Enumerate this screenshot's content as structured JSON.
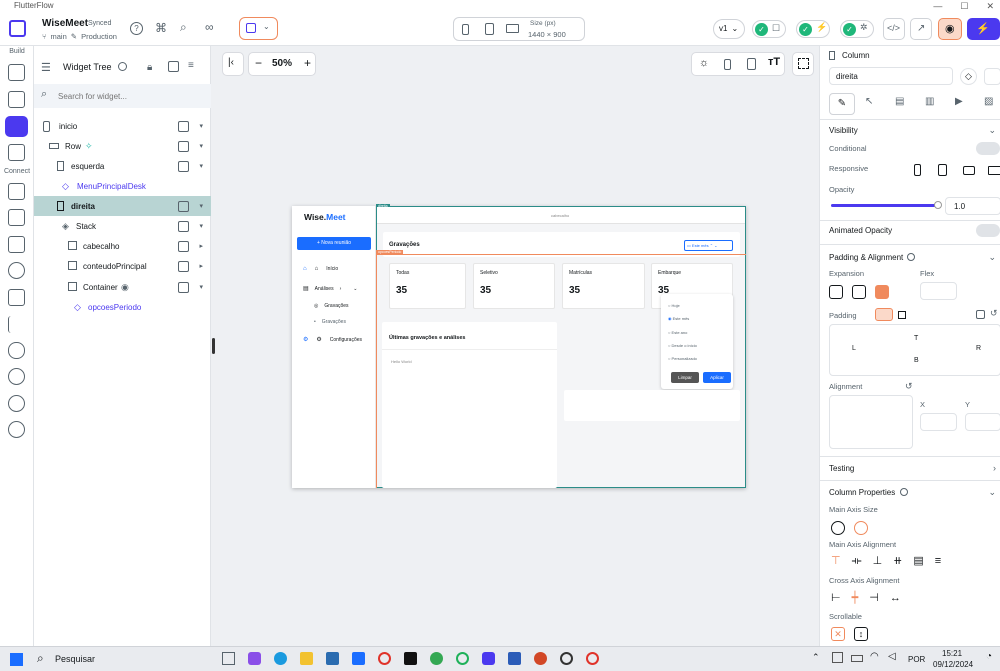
{
  "window": {
    "title": "FlutterFlow"
  },
  "topbar": {
    "project_name": "WiseMeet",
    "sync_status": "Synced",
    "branch": "main",
    "environment": "Production",
    "size_label": "Size (px)",
    "size_value": "1440 × 900",
    "version": "v1"
  },
  "rail": {
    "build_label": "Build",
    "connect_label": "Connect"
  },
  "tree": {
    "title": "Widget Tree",
    "search_placeholder": "Search for widget...",
    "items": [
      {
        "label": "inicio"
      },
      {
        "label": "Row"
      },
      {
        "label": "esquerda"
      },
      {
        "label": "MenuPrincipalDesk"
      },
      {
        "label": "direita"
      },
      {
        "label": "Stack"
      },
      {
        "label": "cabecalho"
      },
      {
        "label": "conteudoPrincipal"
      },
      {
        "label": "Container"
      },
      {
        "label": "opcoesPeriodo"
      }
    ]
  },
  "canvas": {
    "zoom": "50%"
  },
  "preview": {
    "logo_a": "Wise.",
    "logo_b": "Meet",
    "new_meeting_button": "+ Nova reunião",
    "nav": [
      {
        "label": "Início"
      },
      {
        "label": "Análises"
      },
      {
        "label": "Gravações"
      },
      {
        "label": "Gravações"
      },
      {
        "label": "Configurações"
      }
    ],
    "direita_tag": "direita",
    "header_label": "cabecalho",
    "section_title": "Gravações",
    "opcoes_tag": "opcoesPeriodo",
    "period_button": "Este mês",
    "stats": [
      {
        "label": "Todas",
        "value": "35"
      },
      {
        "label": "Seletivo",
        "value": "35"
      },
      {
        "label": "Matrículas",
        "value": "35"
      },
      {
        "label": "Embarque",
        "value": "35"
      }
    ],
    "period_options": [
      "Hoje",
      "Este mês",
      "Este ano",
      "Desde o início",
      "Personalizado"
    ],
    "clear_button": "Limpar",
    "apply_button": "Aplicar",
    "recent_title": "Últimas gravações e análises",
    "recent_body": "Hello World"
  },
  "props": {
    "widget_type": "Column",
    "widget_name": "direita",
    "visibility": "Visibility",
    "conditional": "Conditional",
    "responsive": "Responsive",
    "opacity": "Opacity",
    "opacity_value": 1.0,
    "opacity_text": "1.0",
    "animated_opacity": "Animated Opacity",
    "padding_alignment": "Padding & Alignment",
    "expansion": "Expansion",
    "flex": "Flex",
    "padding": "Padding",
    "pad_t": "T",
    "pad_l": "L",
    "pad_r": "R",
    "pad_b": "B",
    "alignment": "Alignment",
    "align_x": "X",
    "align_y": "Y",
    "testing": "Testing",
    "column_properties": "Column Properties",
    "main_axis_size": "Main Axis Size",
    "main_axis_alignment": "Main Axis Alignment",
    "cross_axis_alignment": "Cross Axis Alignment",
    "scrollable": "Scrollable"
  },
  "taskbar": {
    "search": "Pesquisar",
    "lang": "POR",
    "time": "15:21",
    "date": "09/12/2024"
  },
  "colors": {
    "accent": "#4b39ef",
    "orange": "#f08a5d",
    "selected_row": "#b8d4d3",
    "blue": "#1a6dff"
  }
}
